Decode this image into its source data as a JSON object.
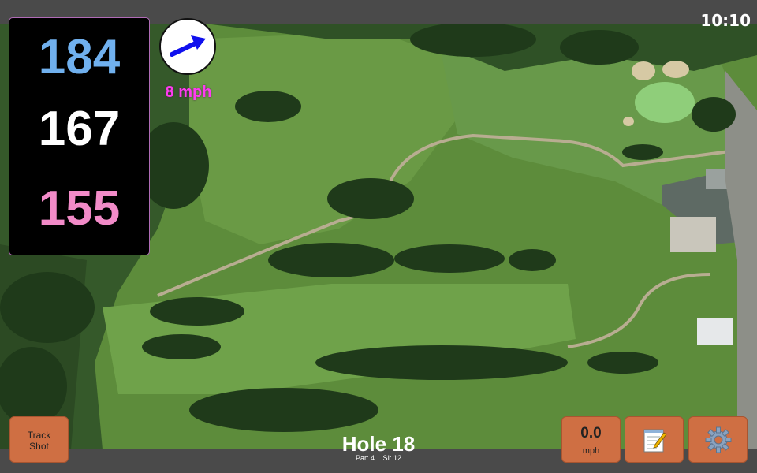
{
  "status": {
    "time": "10:10"
  },
  "distances": {
    "back": "184",
    "middle": "167",
    "front": "155"
  },
  "wind": {
    "speed_label": "8 mph",
    "icon": "wind-direction-arrow-icon"
  },
  "buttons": {
    "track_shot_line1": "Track",
    "track_shot_line2": "Shot",
    "speed_value": "0.0",
    "speed_unit": "mph",
    "notes_icon": "notepad-icon",
    "settings_icon": "gear-icon"
  },
  "hole": {
    "title": "Hole 18",
    "par": "Par: 4",
    "si": "SI: 12"
  },
  "colors": {
    "back_distance": "#70b0ee",
    "middle_distance": "#ffffff",
    "front_distance": "#f28bc8",
    "wind_label": "#ff3cf0",
    "button_bg": "#cf6f43",
    "wind_arrow": "#1010ee"
  }
}
